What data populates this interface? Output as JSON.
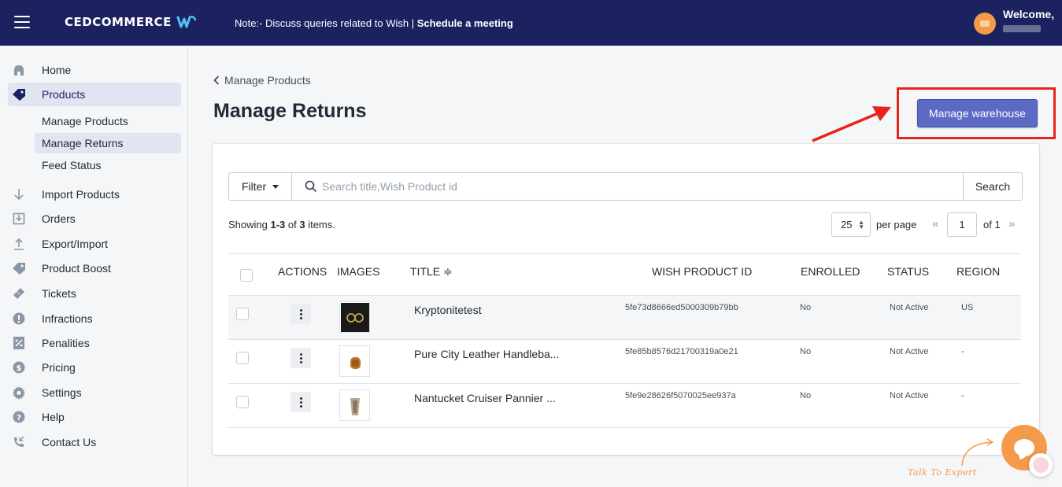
{
  "topbar": {
    "brand": "CEDCOMMERCE",
    "note_prefix": "Note:- Discuss queries related to Wish | ",
    "note_link": "Schedule a meeting",
    "welcome": "Welcome,"
  },
  "sidebar": {
    "items": [
      {
        "label": "Home",
        "icon": "home-icon"
      },
      {
        "label": "Products",
        "icon": "tag-icon"
      },
      {
        "label": "Import Products",
        "icon": "arrow-down-icon"
      },
      {
        "label": "Orders",
        "icon": "orders-icon"
      },
      {
        "label": "Export/Import",
        "icon": "upload-icon"
      },
      {
        "label": "Product Boost",
        "icon": "tag-icon"
      },
      {
        "label": "Tickets",
        "icon": "ticket-icon"
      },
      {
        "label": "Infractions",
        "icon": "alert-icon"
      },
      {
        "label": "Penalities",
        "icon": "percent-icon"
      },
      {
        "label": "Pricing",
        "icon": "dollar-icon"
      },
      {
        "label": "Settings",
        "icon": "gear-icon"
      },
      {
        "label": "Help",
        "icon": "help-icon"
      },
      {
        "label": "Contact Us",
        "icon": "phone-icon"
      }
    ],
    "sub_items": [
      {
        "label": "Manage Products"
      },
      {
        "label": "Manage Returns"
      },
      {
        "label": "Feed Status"
      }
    ]
  },
  "main": {
    "breadcrumb": "Manage Products",
    "title": "Manage Returns",
    "primary_button": "Manage warehouse",
    "filter_label": "Filter",
    "search_placeholder": "Search title,Wish Product id",
    "search_button": "Search",
    "showing_prefix": "Showing ",
    "showing_range": "1-3",
    "showing_mid": " of ",
    "showing_total": "3",
    "showing_suffix": " items.",
    "per_page_value": "25",
    "per_page_label": "per page",
    "prev_page": "«",
    "page_value": "1",
    "of_pages": "of 1",
    "next_page": "»"
  },
  "table": {
    "headers": {
      "actions": "ACTIONS",
      "images": "IMAGES",
      "title": "TITLE ≑",
      "wish_id": "WISH PRODUCT ID",
      "enrolled": "ENROLLED",
      "status": "STATUS",
      "region": "REGION"
    },
    "rows": [
      {
        "title": "Kryptonitetest",
        "wish_id": "5fe73d8666ed5000309b79bb",
        "enrolled": "No",
        "status": "Not Active",
        "region": "US"
      },
      {
        "title": "Pure City Leather Handleba...",
        "wish_id": "5fe85b8576d21700319a0e21",
        "enrolled": "No",
        "status": "Not Active",
        "region": "-"
      },
      {
        "title": "Nantucket Cruiser Pannier ...",
        "wish_id": "5fe9e28626f5070025ee937a",
        "enrolled": "No",
        "status": "Not Active",
        "region": "-"
      }
    ]
  },
  "chat": {
    "label": "Talk To Expert"
  },
  "colors": {
    "topbar": "#1c2260",
    "accent": "#5c6ac4",
    "highlight": "#e8231c",
    "chat": "#f39b4a"
  }
}
